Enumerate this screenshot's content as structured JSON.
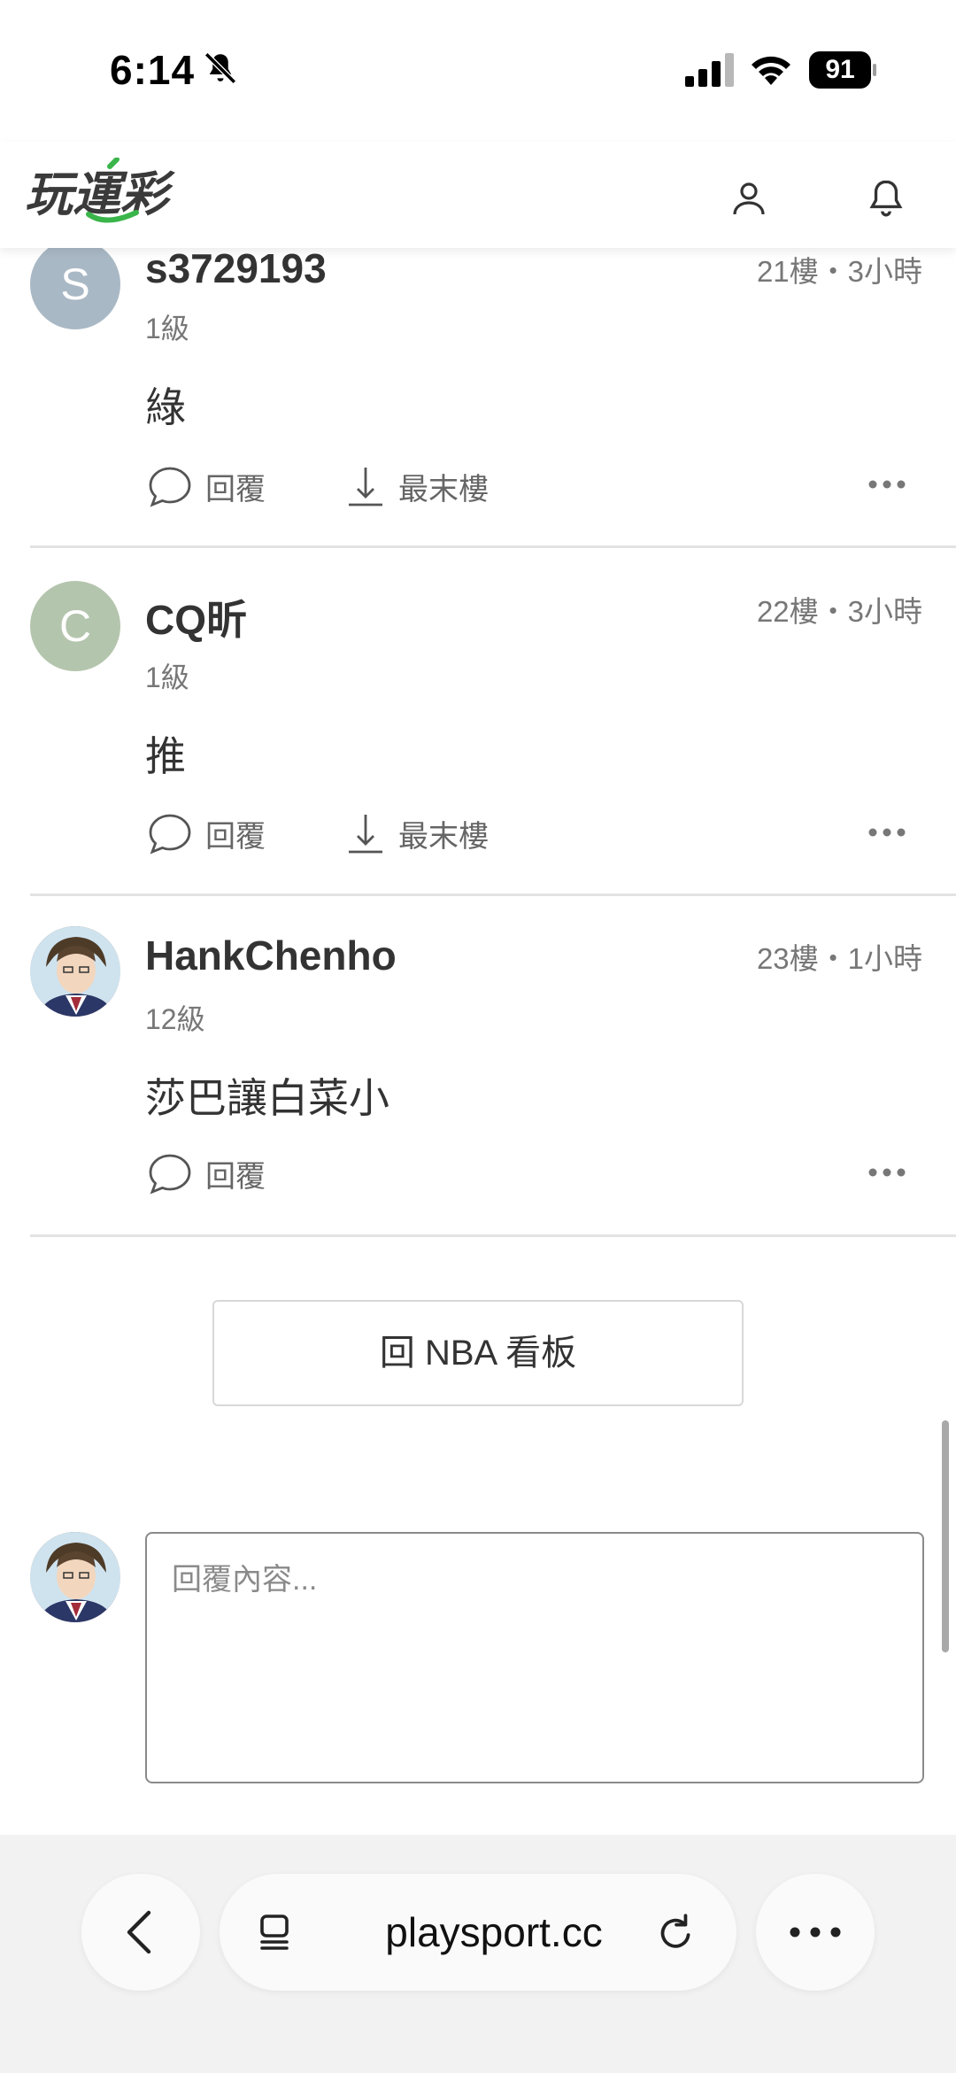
{
  "status_bar": {
    "time": "6:14",
    "battery": "91"
  },
  "header": {
    "logo_text": "玩運彩"
  },
  "comments": [
    {
      "avatar_letter": "S",
      "username": "s3729193",
      "meta": "21樓・3小時",
      "level": "1級",
      "content": "綠",
      "reply_label": "回覆",
      "last_floor_label": "最末樓"
    },
    {
      "avatar_letter": "C",
      "username": "CQ昕",
      "meta": "22樓・3小時",
      "level": "1級",
      "content": "推",
      "reply_label": "回覆",
      "last_floor_label": "最末樓"
    },
    {
      "username": "HankChenho",
      "meta": "23樓・1小時",
      "level": "12級",
      "content": "莎巴讓白菜小",
      "reply_label": "回覆"
    }
  ],
  "back_board_label": "回 NBA 看板",
  "reply_box": {
    "placeholder": "回覆內容..."
  },
  "browser": {
    "url": "playsport.cc"
  }
}
